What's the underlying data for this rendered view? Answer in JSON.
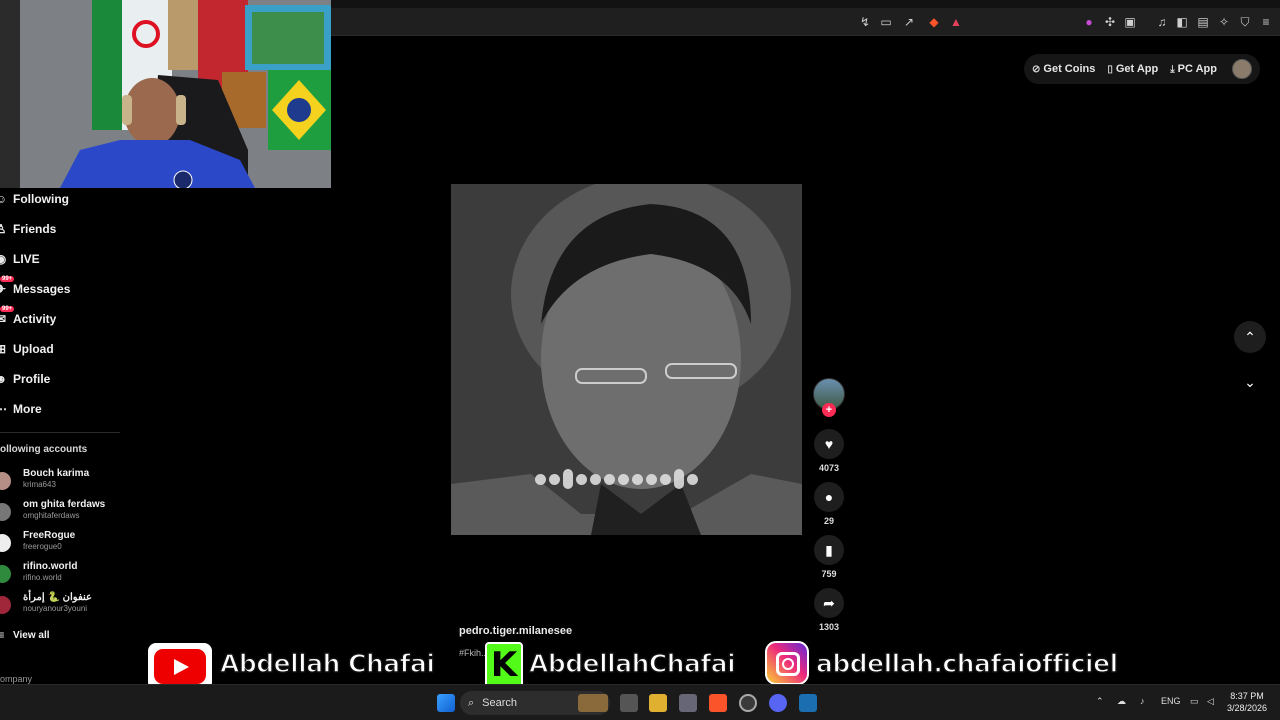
{
  "browser": {
    "right_icons": [
      "translate-off-icon",
      "cast-icon",
      "share-icon",
      "brave-shield-icon",
      "brave-rewards-icon",
      "extension-badge-icon",
      "puzzle-icon",
      "screenshot-icon",
      "media-icon",
      "sidebar-icon",
      "wallet-icon",
      "leo-icon",
      "vpn-icon",
      "menu-icon"
    ]
  },
  "header": {
    "get_coins": "Get Coins",
    "get_app": "Get App",
    "pc_app": "PC App"
  },
  "sidebar": {
    "items": [
      {
        "label": "Following",
        "icon": "following-icon"
      },
      {
        "label": "Friends",
        "icon": "friends-icon"
      },
      {
        "label": "LIVE",
        "icon": "live-icon"
      },
      {
        "label": "Messages",
        "icon": "messages-icon",
        "badge": "99+"
      },
      {
        "label": "Activity",
        "icon": "activity-icon",
        "badge": "99+"
      },
      {
        "label": "Upload",
        "icon": "upload-icon"
      },
      {
        "label": "Profile",
        "icon": "profile-icon"
      },
      {
        "label": "More",
        "icon": "more-icon"
      }
    ],
    "section_title": "ollowing accounts",
    "accounts": [
      {
        "name": "Bouch karima",
        "handle": "krima643"
      },
      {
        "name": "om ghita ferdaws",
        "handle": "omghitaferdaws"
      },
      {
        "name": "FreeRogue",
        "handle": "freerogue0"
      },
      {
        "name": "rifino.world",
        "handle": "rifino.world"
      },
      {
        "name": "عنفوان 🐍 إمرأة",
        "handle": "nouryanour3youni"
      }
    ],
    "view_all": "View all",
    "company": "ompany"
  },
  "video": {
    "author": "pedro.tiger.milanesee",
    "desc": "#Fkih..."
  },
  "actions": {
    "likes": "4073",
    "comments": "29",
    "saves": "759",
    "shares": "1303",
    "follow_plus": "+"
  },
  "banner": {
    "youtube": "Abdellah Chafai",
    "kick_letter": "K",
    "kick": "AbdellahChafai",
    "instagram": "abdellah.chafaiofficiel"
  },
  "taskbar": {
    "search_placeholder": "Search",
    "lang": "ENG",
    "time": "8:37 PM",
    "date": "3/28/2026"
  }
}
